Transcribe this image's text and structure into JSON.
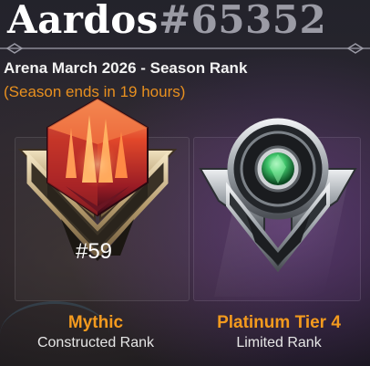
{
  "player": {
    "name": "Aardos",
    "tag": "#65352"
  },
  "season": {
    "title": "Arena March 2026 - Season Rank",
    "ends_text": "(Season ends in 19 hours)"
  },
  "constructed": {
    "rank_name": "Mythic",
    "rank_number": "#59",
    "format_label": "Constructed Rank",
    "emblem_icon": "mythic-crystal-emblem"
  },
  "limited": {
    "rank_name": "Platinum Tier 4",
    "format_label": "Limited Rank",
    "emblem_icon": "platinum-emerald-emblem"
  },
  "colors": {
    "accent_orange": "#f39a1e",
    "season_ends": "#e8901f",
    "tag_gray": "#9b9ba5"
  }
}
